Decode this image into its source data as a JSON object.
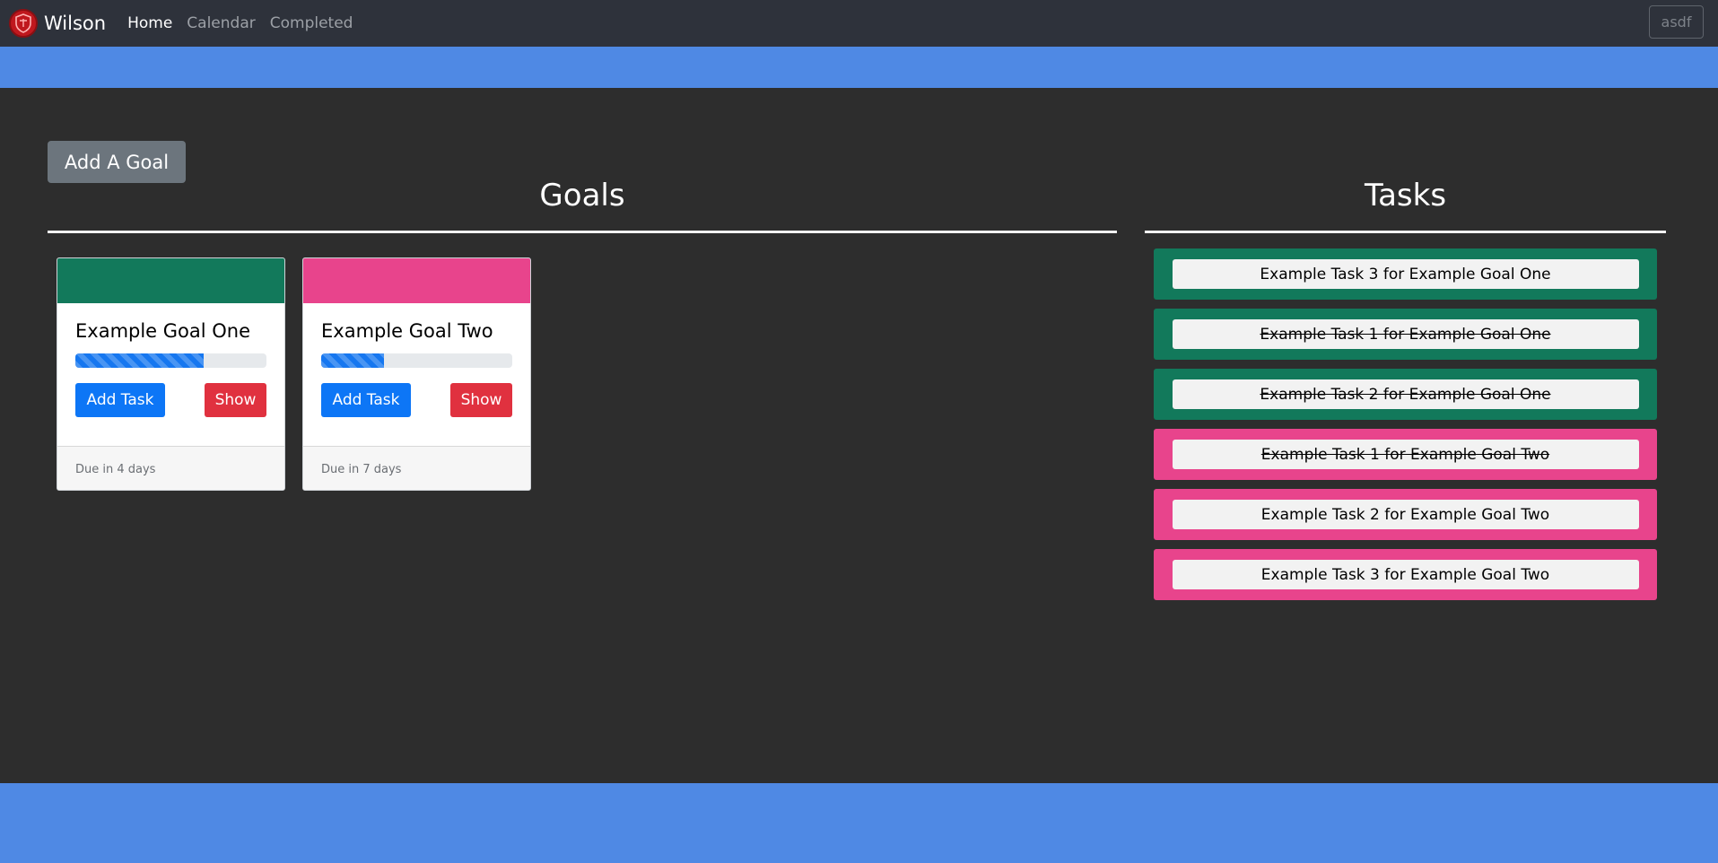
{
  "nav": {
    "brand_name": "Wilson",
    "logo_icon": "shield-crest-icon",
    "links": [
      {
        "label": "Home",
        "active": true
      },
      {
        "label": "Calendar",
        "active": false
      },
      {
        "label": "Completed",
        "active": false
      }
    ],
    "user_label": "asdf"
  },
  "actions": {
    "add_goal_label": "Add A Goal"
  },
  "sections": {
    "goals_title": "Goals",
    "tasks_title": "Tasks"
  },
  "goals": [
    {
      "title": "Example Goal One",
      "color": "#12795b",
      "progress_percent": 67,
      "add_task_label": "Add Task",
      "show_label": "Show",
      "due_text": "Due in 4 days"
    },
    {
      "title": "Example Goal Two",
      "color": "#e8448c",
      "progress_percent": 33,
      "add_task_label": "Add Task",
      "show_label": "Show",
      "due_text": "Due in 7 days"
    }
  ],
  "tasks": [
    {
      "label": "Example Task 3 for Example Goal One",
      "goal_color": "#12795b",
      "completed": false
    },
    {
      "label": "Example Task 1 for Example Goal One",
      "goal_color": "#12795b",
      "completed": true
    },
    {
      "label": "Example Task 2 for Example Goal One",
      "goal_color": "#12795b",
      "completed": true
    },
    {
      "label": "Example Task 1 for Example Goal Two",
      "goal_color": "#e8448c",
      "completed": true
    },
    {
      "label": "Example Task 2 for Example Goal Two",
      "goal_color": "#e8448c",
      "completed": false
    },
    {
      "label": "Example Task 3 for Example Goal Two",
      "goal_color": "#e8448c",
      "completed": false
    }
  ],
  "colors": {
    "navbar_bg": "#2e323b",
    "accent_band": "#4f89e4",
    "page_bg": "#2d2d2d",
    "primary_button": "#0d76f6",
    "danger_button": "#e0313f",
    "secondary_button": "#6c757d"
  }
}
